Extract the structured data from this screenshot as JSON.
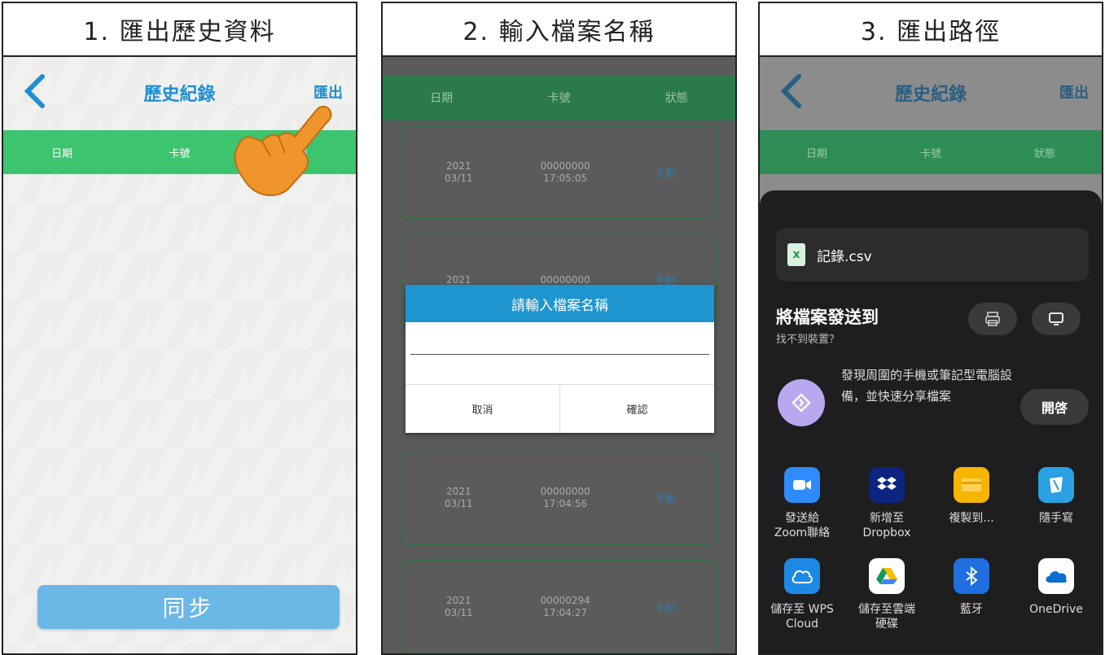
{
  "panel1": {
    "title": "1. 匯出歷史資料",
    "app_title": "歷史紀錄",
    "export_label": "匯出",
    "columns": [
      "日期",
      "卡號",
      "狀態"
    ],
    "sync_label": "同步"
  },
  "panel2": {
    "title": "2. 輸入檔案名稱",
    "columns": [
      "日期",
      "卡號",
      "狀態"
    ],
    "rows": [
      {
        "date": "2021\n03/11",
        "card": "00000000\n17:05:05",
        "status": "手動"
      },
      {
        "date": "2021",
        "card": "00000000",
        "status": "手動"
      },
      {
        "date": "2021\n03/11",
        "card": "00000000\n17:04:56",
        "status": "手動"
      },
      {
        "date": "2021\n03/11",
        "card": "00000294\n17:04:27",
        "status": "手動"
      }
    ],
    "dialog": {
      "title": "請輸入檔案名稱",
      "cancel": "取消",
      "confirm": "確認"
    }
  },
  "panel3": {
    "title": "3. 匯出路徑",
    "app_title": "歷史紀錄",
    "export_label": "匯出",
    "columns": [
      "日期",
      "卡號",
      "狀態"
    ],
    "file_name": "記錄.csv",
    "send_title": "將檔案發送到",
    "no_device": "找不到裝置？",
    "nearby_text": "發現周圍的手機或筆記型電腦設備，並快速分享檔案",
    "open_label": "開啓",
    "apps": [
      {
        "label": "發送給\nZoom聯絡",
        "icon": "zoom-icon",
        "color": "#2d8cff"
      },
      {
        "label": "新增至\nDropbox",
        "icon": "dropbox-icon",
        "color": "#0d2481"
      },
      {
        "label": "複製到...",
        "icon": "folder-icon",
        "color": "#f7b500"
      },
      {
        "label": "隨手寫",
        "icon": "notes-icon",
        "color": "#2aa1e3"
      },
      {
        "label": "儲存至 WPS\nCloud",
        "icon": "wps-cloud-icon",
        "color": "#1e88e5"
      },
      {
        "label": "儲存至雲端\n硬碟",
        "icon": "google-drive-icon",
        "color": "#ffffff"
      },
      {
        "label": "藍牙",
        "icon": "bluetooth-icon",
        "color": "#1f6fe0"
      },
      {
        "label": "OneDrive",
        "icon": "onedrive-icon",
        "color": "#ffffff"
      }
    ]
  }
}
